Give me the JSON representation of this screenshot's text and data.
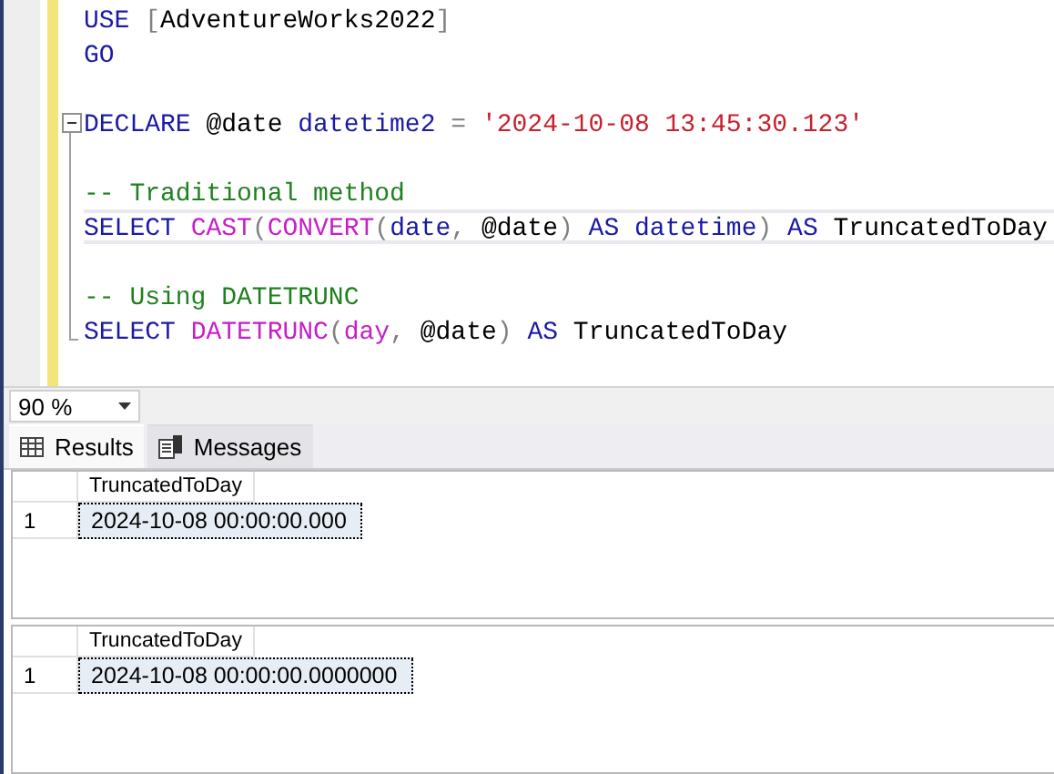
{
  "editor": {
    "lines": [
      {
        "kind": "plain",
        "current": false,
        "tokens": [
          {
            "kind": "keyword",
            "text": "USE"
          },
          {
            "kind": "gray",
            "text": " ["
          },
          {
            "kind": "plain",
            "text": "AdventureWorks2022"
          },
          {
            "kind": "gray",
            "text": "]"
          }
        ]
      },
      {
        "kind": "plain",
        "current": false,
        "tokens": [
          {
            "kind": "keyword",
            "text": "GO"
          }
        ]
      },
      {
        "kind": "plain",
        "current": false
      },
      {
        "kind": "fold-start",
        "current": false,
        "tokens": [
          {
            "kind": "keyword",
            "text": "DECLARE"
          },
          {
            "kind": "plain",
            "text": " @date "
          },
          {
            "kind": "keyword",
            "text": "datetime2"
          },
          {
            "kind": "gray",
            "text": " ="
          },
          {
            "kind": "string",
            "text": " '2024-10-08 13:45:30.123'"
          }
        ]
      },
      {
        "kind": "fold-body",
        "current": false
      },
      {
        "kind": "fold-body",
        "current": false,
        "tokens": [
          {
            "kind": "comment",
            "text": "-- Traditional method"
          }
        ]
      },
      {
        "kind": "fold-body",
        "current": true,
        "tokens": [
          {
            "kind": "keyword",
            "text": "SELECT"
          },
          {
            "kind": "func",
            "text": " CAST"
          },
          {
            "kind": "gray",
            "text": "("
          },
          {
            "kind": "func",
            "text": "CONVERT"
          },
          {
            "kind": "gray",
            "text": "("
          },
          {
            "kind": "keyword",
            "text": "date"
          },
          {
            "kind": "gray",
            "text": ","
          },
          {
            "kind": "plain",
            "text": " @date"
          },
          {
            "kind": "gray",
            "text": ")"
          },
          {
            "kind": "keyword",
            "text": " AS"
          },
          {
            "kind": "keyword",
            "text": " datetime"
          },
          {
            "kind": "gray",
            "text": ")"
          },
          {
            "kind": "keyword",
            "text": " AS"
          },
          {
            "kind": "plain",
            "text": " TruncatedToDay"
          }
        ]
      },
      {
        "kind": "fold-body",
        "current": false
      },
      {
        "kind": "fold-body",
        "current": false,
        "tokens": [
          {
            "kind": "comment",
            "text": "-- Using DATETRUNC"
          }
        ]
      },
      {
        "kind": "fold-end",
        "current": false,
        "tokens": [
          {
            "kind": "keyword",
            "text": "SELECT"
          },
          {
            "kind": "func",
            "text": " DATETRUNC"
          },
          {
            "kind": "gray",
            "text": "("
          },
          {
            "kind": "func",
            "text": "day"
          },
          {
            "kind": "gray",
            "text": ","
          },
          {
            "kind": "plain",
            "text": " @date"
          },
          {
            "kind": "gray",
            "text": ")"
          },
          {
            "kind": "keyword",
            "text": " AS"
          },
          {
            "kind": "plain",
            "text": " TruncatedToDay"
          }
        ]
      }
    ]
  },
  "zoom": {
    "value": "90 %"
  },
  "tabs": [
    {
      "label": "Results",
      "selected": true,
      "kind": "grid"
    },
    {
      "label": "Messages",
      "selected": false,
      "kind": "messages"
    }
  ],
  "grids": [
    {
      "columns": [
        "TruncatedToDay"
      ],
      "rows": [
        {
          "number": "1",
          "cells": [
            {
              "text": "2024-10-08 00:00:00.000",
              "selected": true
            }
          ]
        }
      ]
    },
    {
      "columns": [
        "TruncatedToDay"
      ],
      "rows": [
        {
          "number": "1",
          "cells": [
            {
              "text": "2024-10-08 00:00:00.0000000",
              "selected": true
            }
          ]
        }
      ]
    }
  ]
}
